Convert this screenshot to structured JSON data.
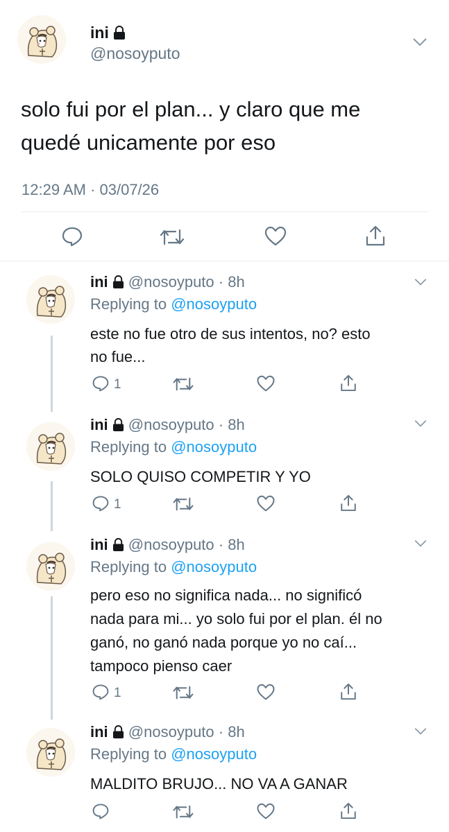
{
  "main_tweet": {
    "display_name": "ini",
    "handle": "@nosoyputo",
    "text_line1": "solo fui por el plan... y claro que me",
    "text_line2": "quedé unicamente por eso",
    "timestamp": "12:29 AM · 03/07/26"
  },
  "replies": [
    {
      "display_name": "ini",
      "handle_time": "@nosoyputo · 8h",
      "replying_prefix": "Replying to",
      "replying_handle": "@nosoyputo",
      "lines": [
        "este no fue otro de sus intentos, no? esto",
        "no fue..."
      ],
      "reply_count": "1"
    },
    {
      "display_name": "ini",
      "handle_time": "@nosoyputo · 8h",
      "replying_prefix": "Replying to",
      "replying_handle": "@nosoyputo",
      "lines": [
        "SOLO QUISO COMPETIR Y YO"
      ],
      "reply_count": "1"
    },
    {
      "display_name": "ini",
      "handle_time": "@nosoyputo · 8h",
      "replying_prefix": "Replying to",
      "replying_handle": "@nosoyputo",
      "lines": [
        "pero eso no significa nada... no significó",
        "nada para mi... yo solo fui por el plan. él no",
        "ganó, no ganó nada porque yo no caí...",
        "tampoco pienso caer"
      ],
      "reply_count": "1"
    },
    {
      "display_name": "ini",
      "handle_time": "@nosoyputo · 8h",
      "replying_prefix": "Replying to",
      "replying_handle": "@nosoyputo",
      "lines": [
        "MALDITO BRUJO... NO VA A GANAR"
      ],
      "reply_count": ""
    }
  ],
  "icons": {
    "lock": "lock-icon",
    "reply": "reply-icon",
    "retweet": "retweet-icon",
    "like": "heart-icon",
    "share": "share-icon",
    "caret": "chevron-down-icon"
  },
  "colors": {
    "link": "#1da1f2",
    "secondary": "#657786",
    "text": "#14171a",
    "divider": "#e6ecf0"
  }
}
